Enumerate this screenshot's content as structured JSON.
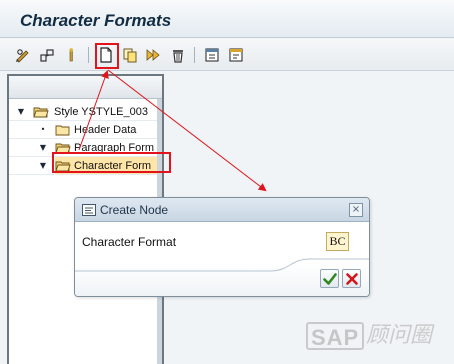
{
  "window": {
    "title": "Character Formats"
  },
  "toolbar": {
    "buttons": [
      {
        "name": "display-change-button",
        "icon": "pencil-glasses-icon"
      },
      {
        "name": "activate-button",
        "icon": "wand-icon"
      },
      {
        "name": "wand-button",
        "icon": "magic-wand-icon"
      },
      {
        "name": "create-button",
        "icon": "new-document-icon"
      },
      {
        "name": "copy-button",
        "icon": "copy-icon"
      },
      {
        "name": "move-button",
        "icon": "double-arrow-icon"
      },
      {
        "name": "delete-button",
        "icon": "trash-icon"
      },
      {
        "name": "window-button",
        "icon": "window-icon"
      },
      {
        "name": "form-button",
        "icon": "form-icon"
      }
    ],
    "highlight_color": "#e0141a"
  },
  "tree": {
    "nodes": [
      {
        "label": "Style YSTYLE_003",
        "expander": "▼",
        "level": 0,
        "selected": false
      },
      {
        "label": "Header Data",
        "expander": "•",
        "level": 1,
        "selected": false
      },
      {
        "label": "Paragraph Form",
        "expander": "▼",
        "level": 1,
        "selected": false
      },
      {
        "label": "Character Form",
        "expander": "▼",
        "level": 1,
        "selected": true
      }
    ],
    "selected_color": "#ffe6a8"
  },
  "dialog": {
    "title": "Create Node",
    "close_glyph": "×",
    "field_label": "Character Format",
    "field_value": "BC",
    "confirm_icon": "check-icon",
    "cancel_icon": "cancel-icon"
  },
  "watermark": {
    "logo_text": "SAP",
    "tagline": "顾问圈"
  }
}
